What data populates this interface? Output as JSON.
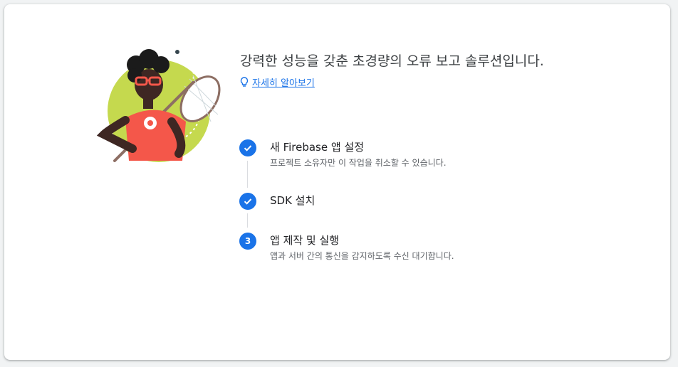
{
  "hero": {
    "headline": "강력한 성능을 갖춘 초경량의 오류 보고 솔루션입니다.",
    "learn_more": "자세히 알아보기",
    "learn_more_icon": "lightbulb-icon"
  },
  "steps": [
    {
      "number": "1",
      "status": "complete",
      "title": "새 Firebase 앱 설정",
      "description": "프로젝트 소유자만 이 작업을 취소할 수 있습니다."
    },
    {
      "number": "2",
      "status": "complete",
      "title": "SDK 설치",
      "description": ""
    },
    {
      "number": "3",
      "status": "current",
      "title": "앱 제작 및 실행",
      "description": "앱과 서버 간의 통신을 감지하도록 수신 대기합니다."
    }
  ],
  "colors": {
    "accent": "#1a73e8",
    "illustration_green": "#c5d94e",
    "shirt_red": "#f4574a"
  }
}
